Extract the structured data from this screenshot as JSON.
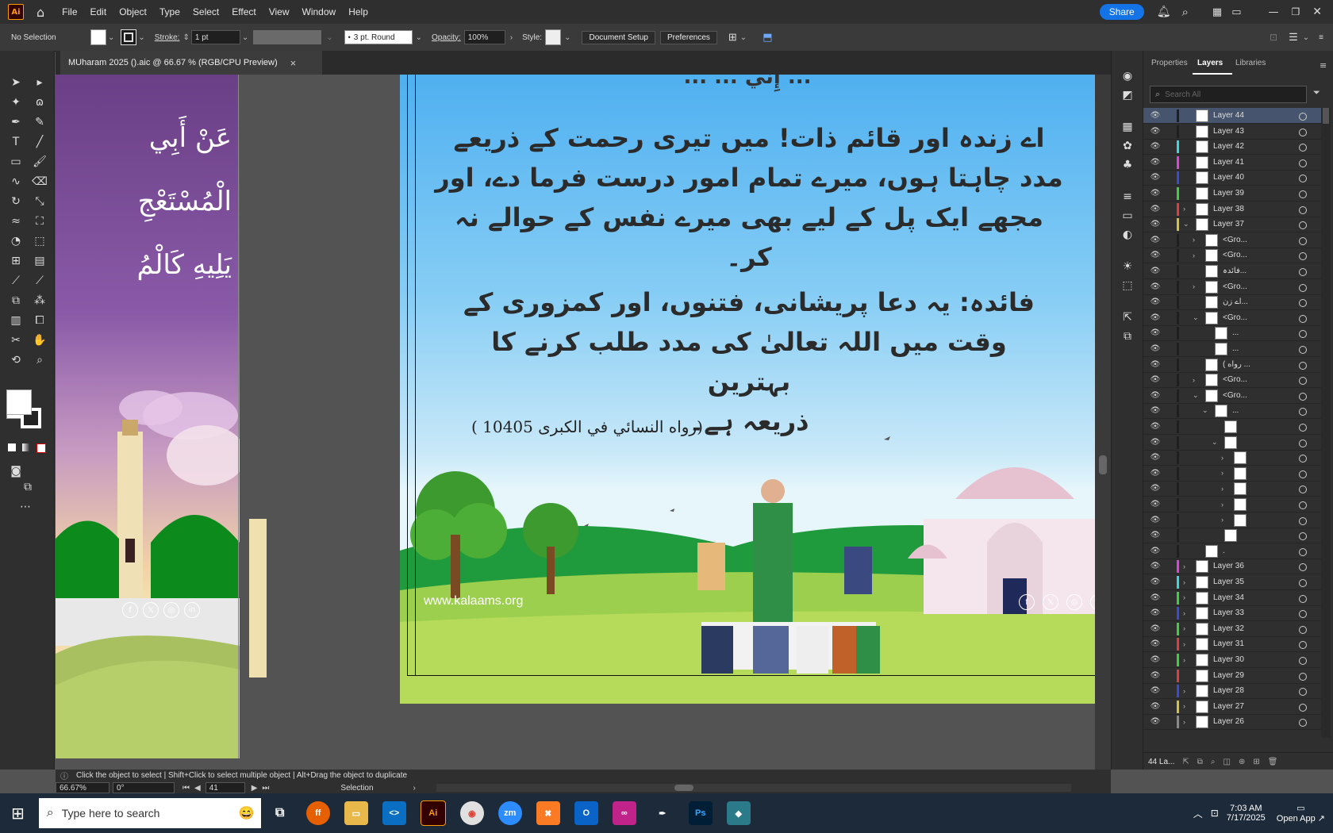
{
  "app": {
    "logo": "Ai"
  },
  "menu": [
    "File",
    "Edit",
    "Object",
    "Type",
    "Select",
    "Effect",
    "View",
    "Window",
    "Help"
  ],
  "menubar_right": {
    "share": "Share"
  },
  "control": {
    "selection": "No Selection",
    "stroke_label": "Stroke:",
    "stroke_value": "1 pt",
    "brush": "3 pt. Round",
    "opacity_label": "Opacity:",
    "opacity_value": "100%",
    "style_label": "Style:",
    "doc_setup": "Document Setup",
    "preferences": "Preferences"
  },
  "document_tab": {
    "title": "MUharam 2025 ().aic @ 66.67 % (RGB/CPU Preview)",
    "close": "×"
  },
  "artboard_left": {
    "arabic_lines": [
      "عَنْ أَبِي",
      "الْمُسْتَعْجِ",
      "يَلِيهِ كَالْمُ"
    ]
  },
  "artboard_main": {
    "top_line": "... إِنِّي ... ...",
    "urdu_dua": [
      "اے زندہ اور قائم ذات! میں تیری رحمت کے ذریعے",
      "مدد چاہتا ہوں، میرے تمام امور درست فرما دے، اور",
      "مجھے ایک پل کے لیے بھی میرے نفس کے حوالے نہ کر۔"
    ],
    "urdu_benefit": [
      "فائدہ: یہ دعا پریشانی، فتنوں، اور کمزوری کے",
      "وقت میں اللہ تعالیٰ کی مدد طلب کرنے کا بہترین",
      "ذریعہ ہے۔"
    ],
    "reference": "(رواه النسائي في الكبرى 10405 )",
    "website": "www.kalaams.org"
  },
  "panel_tabs": [
    "Properties",
    "Layers",
    "Libraries"
  ],
  "layers_search_placeholder": "Search All",
  "layers": [
    {
      "name": "Layer 44",
      "color": "#1f1f1f",
      "tri": "",
      "indent": 0,
      "selected": true
    },
    {
      "name": "Layer 43",
      "color": "#1f1f1f",
      "tri": "",
      "indent": 0
    },
    {
      "name": "Layer 42",
      "color": "#3fd5e0",
      "tri": "",
      "indent": 0
    },
    {
      "name": "Layer 41",
      "color": "#d946d9",
      "tri": "",
      "indent": 0
    },
    {
      "name": "Layer 40",
      "color": "#3a4bd8",
      "tri": "",
      "indent": 0
    },
    {
      "name": "Layer 39",
      "color": "#3fcf3f",
      "tri": "",
      "indent": 0
    },
    {
      "name": "Layer 38",
      "color": "#d94040",
      "tri": "›",
      "indent": 0
    },
    {
      "name": "Layer 37",
      "color": "#d9c03a",
      "tri": "⌄",
      "indent": 0
    },
    {
      "name": "<Gro...",
      "color": "#1f1f1f",
      "tri": "›",
      "indent": 1
    },
    {
      "name": "<Gro...",
      "color": "#1f1f1f",
      "tri": "›",
      "indent": 1
    },
    {
      "name": "فائدہ...",
      "color": "#1f1f1f",
      "tri": "",
      "indent": 1
    },
    {
      "name": "<Gro...",
      "color": "#1f1f1f",
      "tri": "›",
      "indent": 1
    },
    {
      "name": "اے زن...",
      "color": "#1f1f1f",
      "tri": "",
      "indent": 1
    },
    {
      "name": "<Gro...",
      "color": "#1f1f1f",
      "tri": "⌄",
      "indent": 1
    },
    {
      "name": "...",
      "color": "#1f1f1f",
      "tri": "",
      "indent": 2
    },
    {
      "name": "...",
      "color": "#1f1f1f",
      "tri": "",
      "indent": 2
    },
    {
      "name": "( رواه ...",
      "color": "#1f1f1f",
      "tri": "",
      "indent": 1
    },
    {
      "name": "<Gro...",
      "color": "#1f1f1f",
      "tri": "›",
      "indent": 1
    },
    {
      "name": "<Gro...",
      "color": "#1f1f1f",
      "tri": "⌄",
      "indent": 1
    },
    {
      "name": "...",
      "color": "#1f1f1f",
      "tri": "⌄",
      "indent": 2
    },
    {
      "name": "",
      "color": "#1f1f1f",
      "tri": "",
      "indent": 3
    },
    {
      "name": "",
      "color": "#1f1f1f",
      "tri": "⌄",
      "indent": 3
    },
    {
      "name": "",
      "color": "#1f1f1f",
      "tri": "›",
      "indent": 4
    },
    {
      "name": "",
      "color": "#1f1f1f",
      "tri": "›",
      "indent": 4
    },
    {
      "name": "",
      "color": "#1f1f1f",
      "tri": "›",
      "indent": 4
    },
    {
      "name": "",
      "color": "#1f1f1f",
      "tri": "›",
      "indent": 4
    },
    {
      "name": "",
      "color": "#1f1f1f",
      "tri": "›",
      "indent": 4
    },
    {
      "name": "",
      "color": "#1f1f1f",
      "tri": "",
      "indent": 3
    },
    {
      "name": ".",
      "color": "#1f1f1f",
      "tri": "",
      "indent": 1
    },
    {
      "name": "Layer 36",
      "color": "#d946d9",
      "tri": "›",
      "indent": 0
    },
    {
      "name": "Layer 35",
      "color": "#3fd5e0",
      "tri": "›",
      "indent": 0
    },
    {
      "name": "Layer 34",
      "color": "#3fcf3f",
      "tri": "›",
      "indent": 0
    },
    {
      "name": "Layer 33",
      "color": "#3a4bd8",
      "tri": "›",
      "indent": 0
    },
    {
      "name": "Layer 32",
      "color": "#3fcf3f",
      "tri": "›",
      "indent": 0
    },
    {
      "name": "Layer 31",
      "color": "#d94040",
      "tri": "›",
      "indent": 0
    },
    {
      "name": "Layer 30",
      "color": "#3fcf3f",
      "tri": "›",
      "indent": 0
    },
    {
      "name": "Layer 29",
      "color": "#d94040",
      "tri": "",
      "indent": 0
    },
    {
      "name": "Layer 28",
      "color": "#3a4bd8",
      "tri": "›",
      "indent": 0
    },
    {
      "name": "Layer 27",
      "color": "#d9c03a",
      "tri": "›",
      "indent": 0
    },
    {
      "name": "Layer 26",
      "color": "#888888",
      "tri": "›",
      "indent": 0
    }
  ],
  "layers_footer": "44 La...",
  "status": {
    "hint": "Click the object to select  |  Shift+Click to select multiple object  |  Alt+Drag the object to duplicate",
    "zoom": "66.67%",
    "rotation": "0°",
    "artboard": "41",
    "tool": "Selection"
  },
  "taskbar": {
    "search_placeholder": "Type here to search",
    "time": "7:03 AM",
    "date": "7/17/2025",
    "open_app": "Open App ↗"
  }
}
